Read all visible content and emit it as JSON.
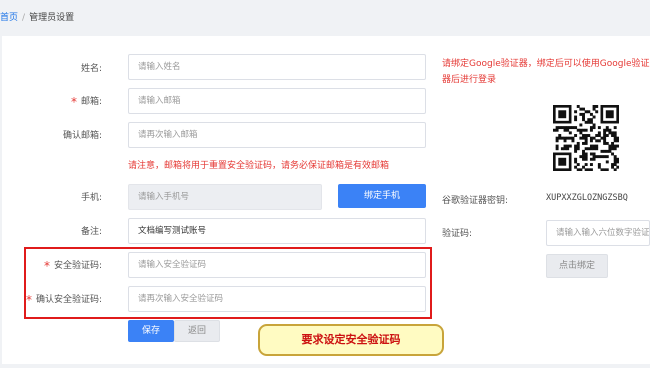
{
  "breadcrumb": {
    "home": "首页",
    "sep": "/",
    "current": "管理员设置"
  },
  "form": {
    "name": {
      "label": "姓名:",
      "placeholder": "请输入姓名"
    },
    "email": {
      "label": "邮箱:",
      "placeholder": "请输入邮箱",
      "required": "*"
    },
    "confirm_email": {
      "label": "确认邮箱:",
      "placeholder": "请再次输入邮箱"
    },
    "email_note": "请注意，邮箱将用于重置安全验证码，请务必保证邮箱是有效邮箱",
    "phone": {
      "label": "手机:",
      "placeholder": "请输入手机号",
      "button": "绑定手机"
    },
    "remark": {
      "label": "备注:",
      "value": "文档编写测试账号"
    },
    "security_code": {
      "label": "安全验证码:",
      "placeholder": "请输入安全验证码",
      "required": "*"
    },
    "confirm_security_code": {
      "label": "确认安全验证码:",
      "placeholder": "请再次输入安全验证码",
      "required": "*"
    },
    "save_button": "保存",
    "back_button": "返回"
  },
  "google": {
    "notice": "请绑定Google验证器，绑定后可以使用Google验证器后进行登录",
    "secret_label": "谷歌验证器密钥:",
    "secret_value": "XUPXXZGLOZNGZSBQ",
    "code_label": "验证码:",
    "code_placeholder": "请输入输入六位数字验证码",
    "bind_button": "点击绑定",
    "qr_icon": "qr-code-icon"
  },
  "annotation": {
    "callout_text": "要求设定安全验证码"
  },
  "colors": {
    "primary": "#3b82f6",
    "danger": "#e53935",
    "highlight": "#e01b1b",
    "callout_bg": "#fffbc2"
  }
}
